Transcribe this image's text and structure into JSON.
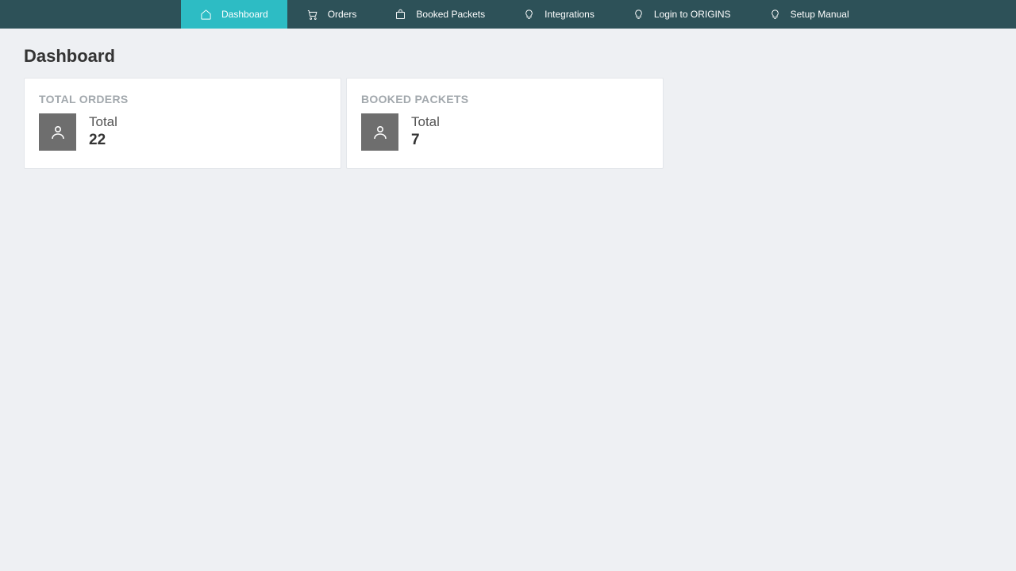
{
  "nav": {
    "items": [
      {
        "label": "Dashboard"
      },
      {
        "label": "Orders"
      },
      {
        "label": "Booked Packets"
      },
      {
        "label": "Integrations"
      },
      {
        "label": "Login to ORIGINS"
      },
      {
        "label": "Setup Manual"
      }
    ]
  },
  "page": {
    "title": "Dashboard"
  },
  "cards": {
    "total_orders": {
      "title": "TOTAL ORDERS",
      "sub": "Total",
      "value": "22"
    },
    "booked_packets": {
      "title": "BOOKED PACKETS",
      "sub": "Total",
      "value": "7"
    }
  }
}
